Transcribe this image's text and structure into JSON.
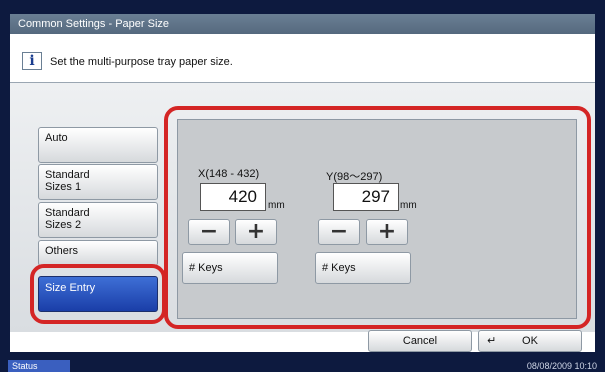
{
  "window": {
    "title": "Common Settings - Paper Size"
  },
  "info": {
    "icon": "info-icon",
    "text": "Set the multi-purpose tray paper size."
  },
  "tabs": [
    {
      "label": "Auto",
      "active": false
    },
    {
      "label": "Standard\nSizes 1",
      "active": false
    },
    {
      "label": "Standard\nSizes 2",
      "active": false
    },
    {
      "label": "Others",
      "active": false
    },
    {
      "label": "Size Entry",
      "active": true
    }
  ],
  "size_entry": {
    "x": {
      "label": "X(148 - 432)",
      "value": "420",
      "unit": "mm",
      "keys_label": "# Keys"
    },
    "y": {
      "label": "Y(98〜297)",
      "value": "297",
      "unit": "mm",
      "keys_label": "# Keys"
    },
    "minus_symbol": "−",
    "plus_symbol": "+"
  },
  "buttons": {
    "cancel": "Cancel",
    "ok": "OK"
  },
  "status": {
    "label": "Status",
    "datetime": "08/08/2009  10:10"
  },
  "colors": {
    "highlight": "#d42525",
    "active_tab": "#1a3ea8",
    "titlebar": "#6a7f94"
  }
}
